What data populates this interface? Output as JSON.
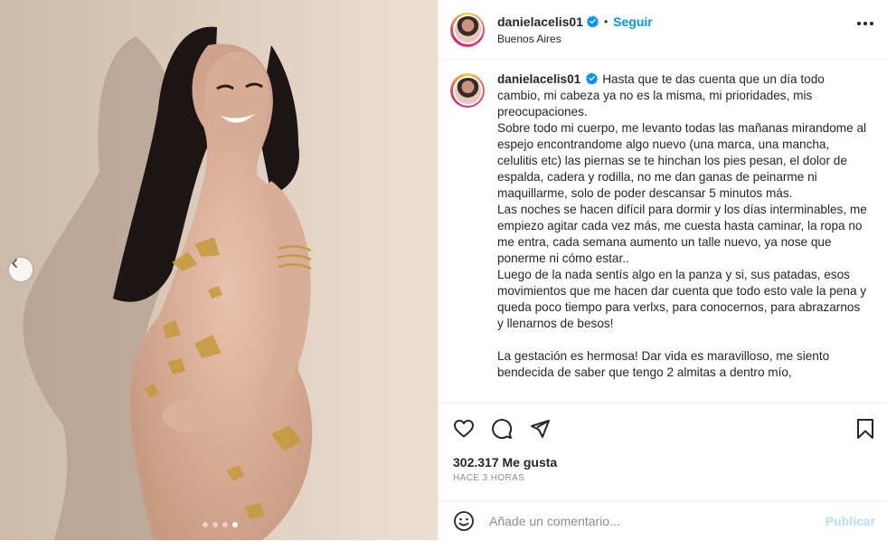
{
  "post": {
    "username": "danielacelis01",
    "follow_label": "Seguir",
    "separator": "•",
    "location": "Buenos Aires",
    "caption_text": "Hasta que te das cuenta que un día todo cambio, mi cabeza ya no es la misma, mi prioridades, mis preocupaciones.\nSobre todo mi cuerpo, me levanto todas las mañanas mirandome al espejo encontrandome algo nuevo (una marca, una mancha, celulitis etc) las piernas se te hinchan los pies pesan, el dolor de espalda, cadera y rodilla, no me dan ganas de peinarme ni maquillarme, solo de poder descansar 5 minutos más.\nLas noches se hacen difícil para dormir y los días interminables, me empiezo agitar cada vez más, me cuesta hasta caminar, la ropa no me entra, cada semana aumento un talle nuevo, ya nose que ponerme ni cómo estar..\nLuego de la nada sentís algo en la panza y si, sus patadas, esos movimientos que me hacen dar cuenta que todo esto vale la pena y queda poco tiempo para verlxs, para conocernos, para abrazarnos y llenarnos de besos!\n\nLa gestación es hermosa! Dar vida es maravilloso, me siento bendecida de saber que tengo 2 almitas a dentro mío,",
    "likes": "302.317 Me gusta",
    "timestamp": "HACE 3 HORAS",
    "comment_placeholder": "Añade un comentario...",
    "publish_label": "Publicar"
  },
  "carousel": {
    "total_slides": 4,
    "active_slide": 4
  },
  "icons": {
    "verified": "verified-badge-icon",
    "more": "more-options-icon",
    "like": "heart-icon",
    "comment": "comment-icon",
    "share": "share-icon",
    "save": "bookmark-icon",
    "emoji": "emoji-icon",
    "prev": "chevron-left-icon"
  },
  "colors": {
    "accent": "#0095f6",
    "verified": "#0095f6",
    "publish_disabled": "#b2dffc",
    "muted": "#8e8e8e",
    "text": "#262626"
  }
}
